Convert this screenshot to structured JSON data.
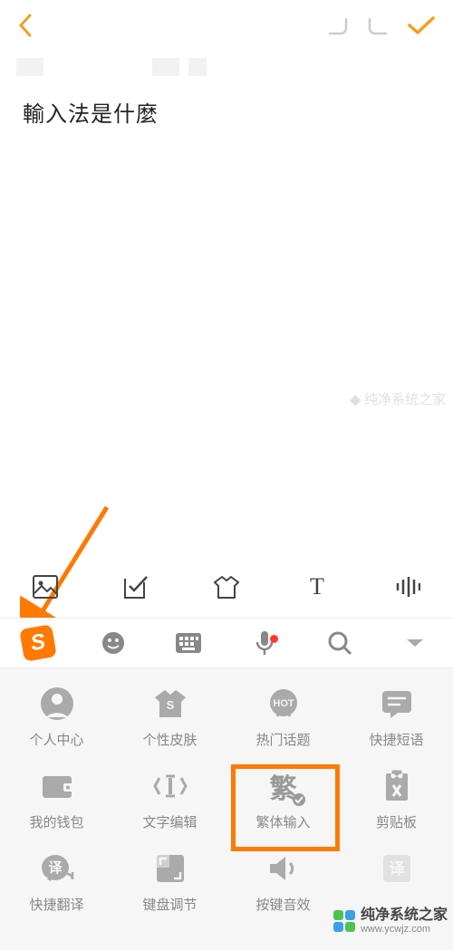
{
  "header": {
    "back": "‹",
    "confirm": "✓"
  },
  "input_text": "輸入法是什麼",
  "top_row": [
    {
      "name": "image-icon"
    },
    {
      "name": "checkbox-icon"
    },
    {
      "name": "tshirt-icon"
    },
    {
      "name": "text-icon",
      "label": "T"
    },
    {
      "name": "audio-bars-icon"
    }
  ],
  "toolbar": [
    {
      "name": "sogou-logo-icon"
    },
    {
      "name": "emoji-icon"
    },
    {
      "name": "keyboard-icon"
    },
    {
      "name": "mic-icon",
      "badge": true
    },
    {
      "name": "search-icon"
    },
    {
      "name": "collapse-icon"
    }
  ],
  "tools": [
    {
      "name": "user-icon",
      "label": "个人中心"
    },
    {
      "name": "skin-icon",
      "label": "个性皮肤"
    },
    {
      "name": "hot-icon",
      "label": "热门话题"
    },
    {
      "name": "phrases-icon",
      "label": "快捷短语"
    },
    {
      "name": "wallet-icon",
      "label": "我的钱包"
    },
    {
      "name": "edit-icon",
      "label": "文字编辑"
    },
    {
      "name": "trad-icon",
      "label": "繁体输入",
      "highlight": true,
      "glyph": "繁"
    },
    {
      "name": "clipboard-icon",
      "label": "剪贴板"
    },
    {
      "name": "translate-icon",
      "label": "快捷翻译",
      "glyph": "译"
    },
    {
      "name": "kbadj-icon",
      "label": "键盘调节"
    },
    {
      "name": "sound-icon",
      "label": "按键音效"
    },
    {
      "name": "trans2-icon",
      "label": "",
      "glyph": "译"
    }
  ],
  "watermark": {
    "cn": "纯净系统之家",
    "url": "www.ycwjz.com"
  }
}
